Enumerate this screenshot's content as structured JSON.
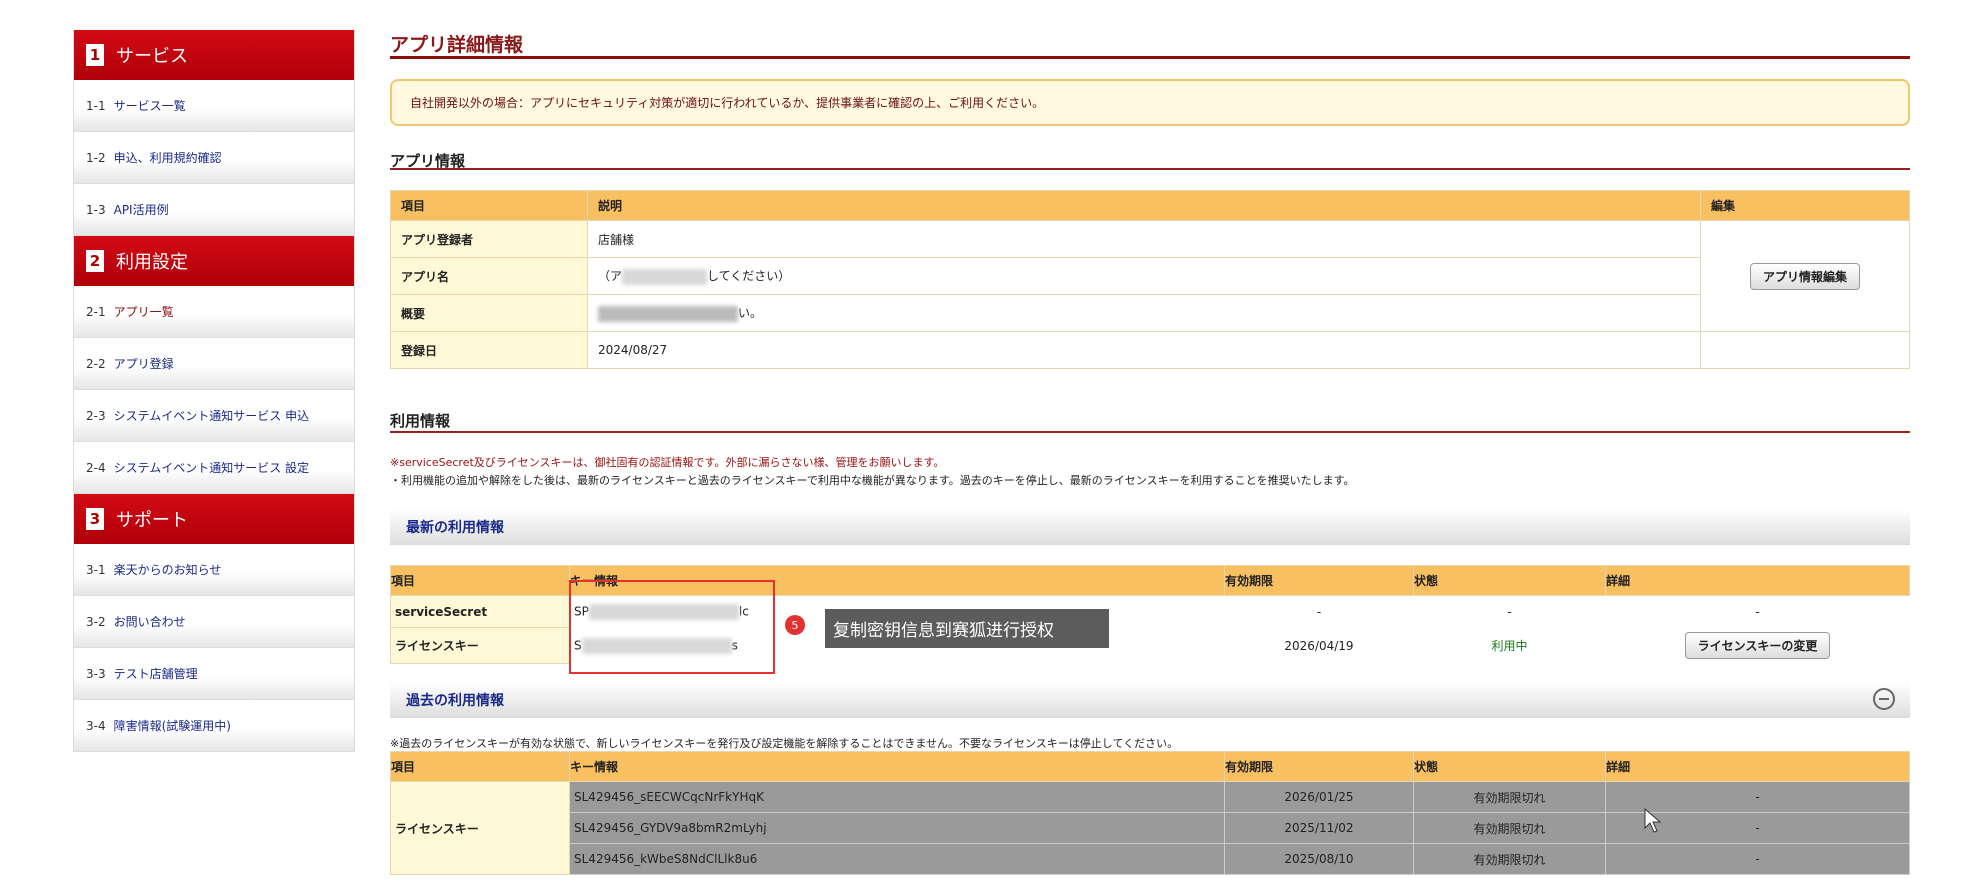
{
  "sidebar": {
    "sections": [
      {
        "num": "1",
        "label": "サービス",
        "items": [
          {
            "n": "1-1",
            "label": "サービス一覧"
          },
          {
            "n": "1-2",
            "label": "申込、利用規約確認"
          },
          {
            "n": "1-3",
            "label": "API活用例"
          }
        ]
      },
      {
        "num": "2",
        "label": "利用設定",
        "items": [
          {
            "n": "2-1",
            "label": "アプリ一覧"
          },
          {
            "n": "2-2",
            "label": "アプリ登録"
          },
          {
            "n": "2-3",
            "label": "システムイベント通知サービス 申込"
          },
          {
            "n": "2-4",
            "label": "システムイベント通知サービス 設定"
          }
        ]
      },
      {
        "num": "3",
        "label": "サポート",
        "items": [
          {
            "n": "3-1",
            "label": "楽天からのお知らせ"
          },
          {
            "n": "3-2",
            "label": "お問い合わせ"
          },
          {
            "n": "3-3",
            "label": "テスト店舗管理"
          },
          {
            "n": "3-4",
            "label": "障害情報(試験運用中)"
          }
        ]
      }
    ]
  },
  "page_title": "アプリ詳細情報",
  "notice": "自社開発以外の場合：アプリにセキュリティ対策が適切に行われているか、提供事業者に確認の上、ご利用ください。",
  "app_info": {
    "heading": "アプリ情報",
    "headers": [
      "項目",
      "説明",
      "編集"
    ],
    "rows": [
      {
        "label": "アプリ登録者",
        "value": "店舗様"
      },
      {
        "label": "アプリ名",
        "value": "（ア",
        "value_end": "してください）"
      },
      {
        "label": "概要",
        "value": "",
        "value_end": "い。"
      },
      {
        "label": "登録日",
        "value": "2024/08/27"
      }
    ],
    "edit_button": "アプリ情報編集"
  },
  "usage": {
    "heading": "利用情報",
    "note_red": "※serviceSecret及びライセンスキーは、御社固有の認証情報です。外部に漏らさない様、管理をお願いします。",
    "note": "・利用機能の追加や解除をした後は、最新のライセンスキーと過去のライセンスキーで利用中な機能が異なります。過去のキーを停止し、最新のライセンスキーを利用することを推奨いたします。",
    "latest": {
      "title": "最新の利用情報",
      "headers": [
        "項目",
        "キー情報",
        "有効期限",
        "状態",
        "詳細"
      ],
      "rows": [
        {
          "label": "serviceSecret",
          "key_start": "SP",
          "key_end": "lc",
          "expiry": "-",
          "status": "-",
          "detail": "-"
        },
        {
          "label": "ライセンスキー",
          "key_start": "S",
          "key_end": "s",
          "expiry": "2026/04/19",
          "status": "利用中",
          "button": "ライセンスキーの変更"
        }
      ]
    },
    "tooltip": {
      "badge": "5",
      "text": "复制密钥信息到赛狐进行授权"
    },
    "past": {
      "title": "過去の利用情報",
      "note": "※過去のライセンスキーが有効な状態で、新しいライセンスキーを発行及び設定機能を解除することはできません。不要なライセンスキーは停止してください。",
      "headers": [
        "項目",
        "キー情報",
        "有効期限",
        "状態",
        "詳細"
      ],
      "label": "ライセンスキー",
      "rows": [
        {
          "key": "SL429456_sEECWCqcNrFkYHqK",
          "expiry": "2026/01/25",
          "status": "有効期限切れ",
          "detail": "-"
        },
        {
          "key": "SL429456_GYDV9a8bmR2mLyhj",
          "expiry": "2025/11/02",
          "status": "有効期限切れ",
          "detail": "-"
        },
        {
          "key": "SL429456_kWbeS8NdClLlk8u6",
          "expiry": "2025/08/10",
          "status": "有効期限切れ",
          "detail": "-"
        }
      ]
    }
  }
}
